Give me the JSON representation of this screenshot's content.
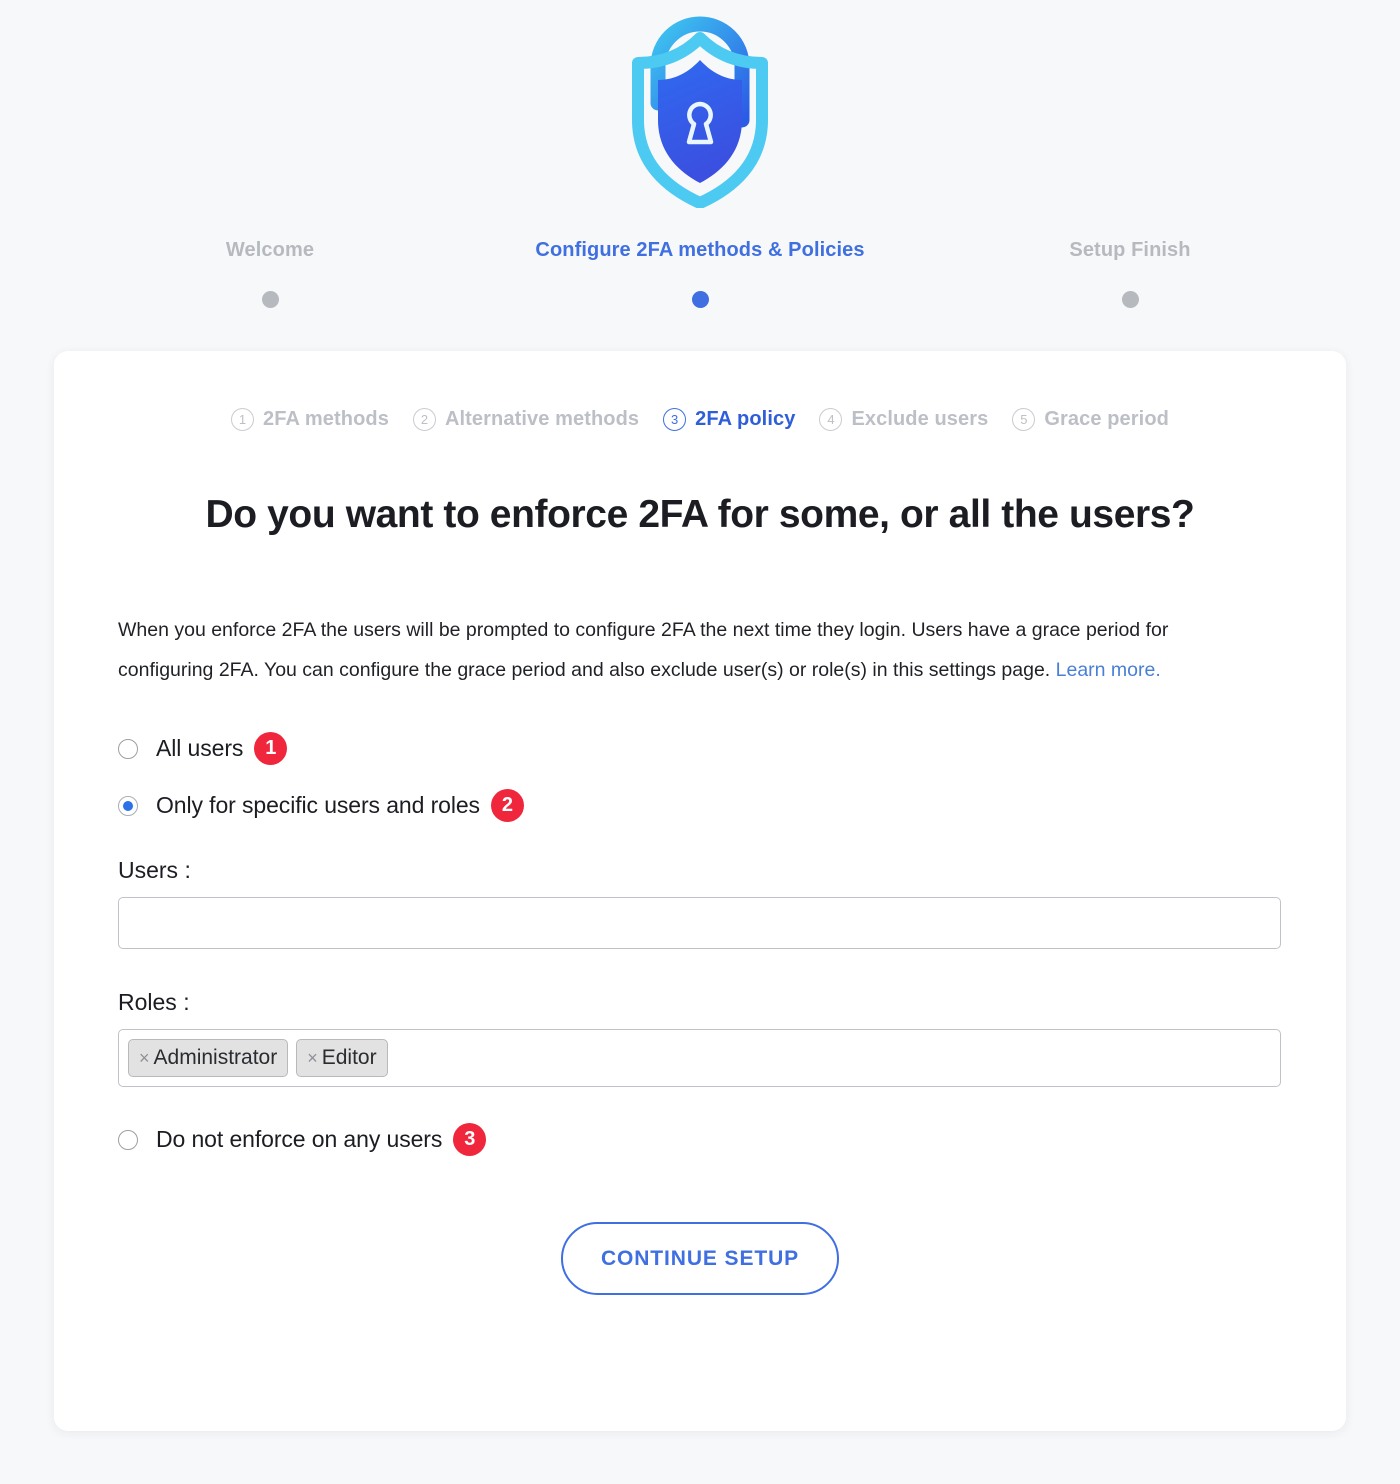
{
  "logo": {
    "icon": "shield-lock-icon",
    "outer_color": "#3ec6f0",
    "inner_color": "#2b5ce6"
  },
  "wizard": {
    "steps": [
      {
        "label": "Welcome",
        "active": false
      },
      {
        "label": "Configure 2FA methods & Policies",
        "active": true
      },
      {
        "label": "Setup Finish",
        "active": false
      }
    ],
    "active_color": "#3f6fe0",
    "inactive_color": "#b6b9be"
  },
  "subtabs": [
    {
      "num": "1",
      "label": "2FA methods",
      "active": false
    },
    {
      "num": "2",
      "label": "Alternative methods",
      "active": false
    },
    {
      "num": "3",
      "label": "2FA policy",
      "active": true
    },
    {
      "num": "4",
      "label": "Exclude users",
      "active": false
    },
    {
      "num": "5",
      "label": "Grace period",
      "active": false
    }
  ],
  "main": {
    "heading": "Do you want to enforce 2FA for some, or all the users?",
    "description_part1": "When you enforce 2FA the users will be prompted to configure 2FA the next time they login. Users have a grace period for configuring 2FA. You can configure the grace period and also exclude user(s) or role(s) in this settings page. ",
    "description_link": "Learn more.",
    "options": [
      {
        "label": "All users",
        "badge": "1",
        "checked": false
      },
      {
        "label": "Only for specific users and roles",
        "badge": "2",
        "checked": true
      },
      {
        "label": "Do not enforce on any users",
        "badge": "3",
        "checked": false
      }
    ],
    "users_field": {
      "label": "Users :",
      "value": "",
      "placeholder": ""
    },
    "roles_field": {
      "label": "Roles :",
      "chips": [
        {
          "remove_icon": "×",
          "label": "Administrator"
        },
        {
          "remove_icon": "×",
          "label": "Editor"
        }
      ]
    },
    "continue_button": "CONTINUE SETUP"
  },
  "colors": {
    "page_background": "#f7f8fa",
    "card_background": "#ffffff",
    "accent_blue": "#3f6fe0",
    "link_blue": "#4a7fd6",
    "badge_red": "#f0263c",
    "muted_gray": "#bcbfc6"
  }
}
